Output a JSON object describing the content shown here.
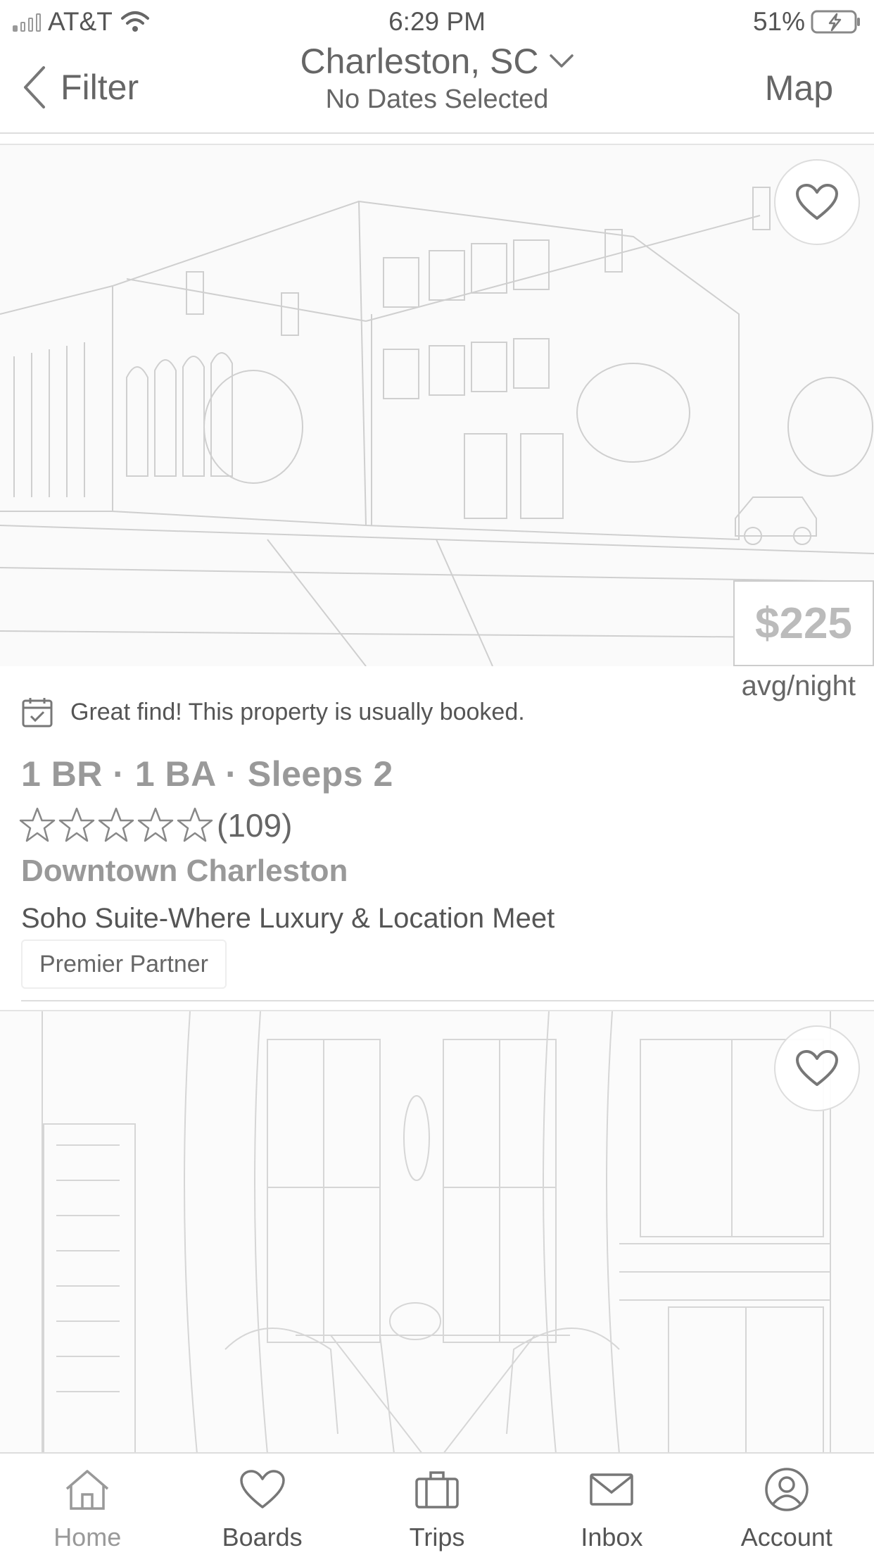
{
  "status_bar": {
    "carrier": "AT&T",
    "time": "6:29 PM",
    "battery": "51%"
  },
  "header": {
    "back_label": "Filter",
    "location": "Charleston, SC",
    "dates": "No Dates Selected",
    "map_label": "Map"
  },
  "listing": {
    "price": "$225",
    "price_unit": "avg/night",
    "notice": "Great find! This property is usually booked.",
    "specs": "1 BR · 1 BA · Sleeps 2",
    "rating_stars": 0,
    "rating_count": "(109)",
    "area": "Downtown Charleston",
    "title": "Soho Suite-Where Luxury & Location Meet",
    "badge": "Premier Partner"
  },
  "tabs": [
    {
      "label": "Home",
      "icon": "home-icon",
      "active": true
    },
    {
      "label": "Boards",
      "icon": "heart-icon",
      "active": false
    },
    {
      "label": "Trips",
      "icon": "suitcase-icon",
      "active": false
    },
    {
      "label": "Inbox",
      "icon": "envelope-icon",
      "active": false
    },
    {
      "label": "Account",
      "icon": "user-icon",
      "active": false
    }
  ]
}
